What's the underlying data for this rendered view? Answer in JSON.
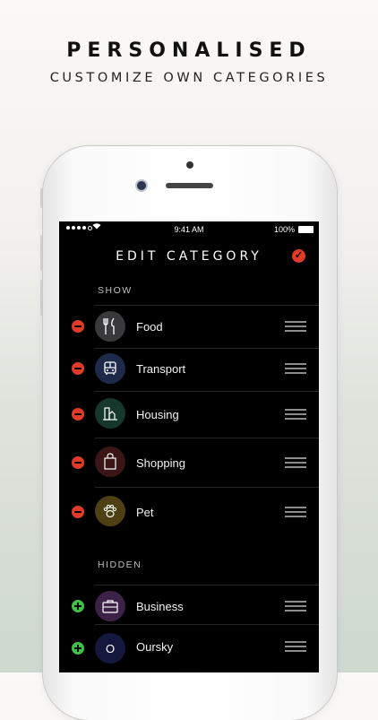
{
  "promo": {
    "headline": "PERSONALISED",
    "subheadline": "CUSTOMIZE OWN CATEGORIES"
  },
  "status_bar": {
    "time": "9:41 AM",
    "battery": "100%"
  },
  "nav": {
    "title": "EDIT CATEGORY",
    "confirm_icon": "check-icon",
    "accent_color": "#e03a2a"
  },
  "sections": {
    "show_label": "SHOW",
    "hidden_label": "HIDDEN"
  },
  "shown_categories": [
    {
      "label": "Food",
      "icon": "fork-knife-icon",
      "color": "#3a3a3c"
    },
    {
      "label": "Transport",
      "icon": "bus-icon",
      "color": "#1f2a4a"
    },
    {
      "label": "Housing",
      "icon": "building-icon",
      "color": "#16372c"
    },
    {
      "label": "Shopping",
      "icon": "shopping-bag-icon",
      "color": "#3a1616"
    },
    {
      "label": "Pet",
      "icon": "paw-icon",
      "color": "#4e4012"
    }
  ],
  "hidden_categories": [
    {
      "label": "Business",
      "icon": "briefcase-icon",
      "color": "#3c2246"
    },
    {
      "label": "Oursky",
      "icon": "circle-o-icon",
      "color": "#14183e",
      "glyph": "O"
    }
  ],
  "action_colors": {
    "remove": "#e03a2a",
    "add": "#41c043"
  }
}
